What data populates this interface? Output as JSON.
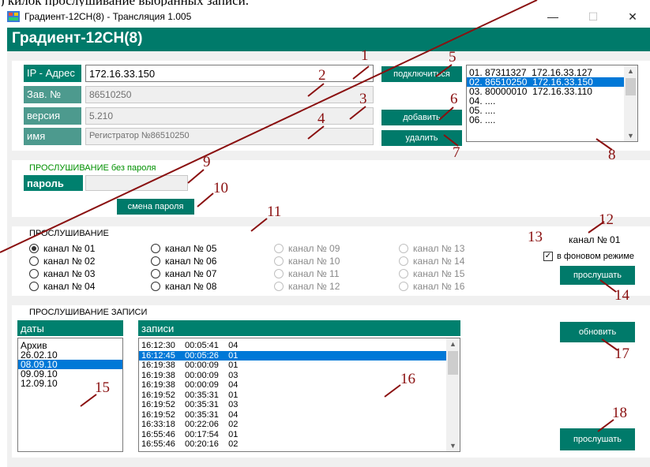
{
  "doc_caption": ") килок прослушивание выбранных записи.",
  "window": {
    "title": "Градиент-12СН(8) - Трансляция 1.005",
    "minimize_glyph": "—",
    "maximize_glyph": "☐",
    "close_glyph": "✕"
  },
  "header": {
    "title": "Градиент-12СН(8)"
  },
  "connection": {
    "ip_label": "IP - Адрес",
    "ip_value": "172.16.33.150",
    "serial_label": "Зав. №",
    "serial_value": "86510250",
    "version_label": "версия",
    "version_value": "5.210",
    "name_label": "имя",
    "name_value": "Регистратор №86510250",
    "connect_button": "подключиться",
    "add_button": "добавить",
    "delete_button": "удалить"
  },
  "devices": [
    "01. 87311327  172.16.33.127",
    "02. 86510250  172.16.33.150",
    "03. 80000010  172.16.33.110",
    "04. ....",
    "05. ....",
    "06. ...."
  ],
  "devices_selected_index": 1,
  "password": {
    "heading_main": "ПРОСЛУШИВАНИЕ",
    "heading_rest": " без пароля",
    "label": "пароль",
    "value": "",
    "change_button": "смена пароля"
  },
  "listening": {
    "heading": "ПРОСЛУШИВАНИЕ",
    "channels": [
      "канал № 01",
      "канал № 02",
      "канал № 03",
      "канал № 04",
      "канал № 05",
      "канал № 06",
      "канал № 07",
      "канал № 08",
      "канал № 09",
      "канал № 10",
      "канал № 11",
      "канал № 12",
      "канал № 13",
      "канал № 14",
      "канал № 15",
      "канал № 16"
    ],
    "selected_channel_index": 0,
    "current_channel": "канал № 01",
    "background_label": "в фоновом режиме",
    "background_checked": true,
    "listen_button": "прослушать"
  },
  "records": {
    "heading": "ПРОСЛУШИВАНИЕ ЗАПИСИ",
    "dates_label": "даты",
    "dates": [
      "Архив",
      "26.02.10",
      "08.09.10",
      "09.09.10",
      "12.09.10"
    ],
    "dates_selected_index": 2,
    "records_label": "записи",
    "rows": [
      "16:12:30    00:05:41    04",
      "16:12:45    00:05:26    01",
      "16:19:38    00:00:09    01",
      "16:19:38    00:00:09    03",
      "16:19:38    00:00:09    04",
      "16:19:52    00:35:31    01",
      "16:19:52    00:35:31    03",
      "16:19:52    00:35:31    04",
      "16:33:18    00:22:06    02",
      "16:55:46    00:17:54    01",
      "16:55:46    00:20:16    02"
    ],
    "rows_selected_index": 1,
    "refresh_button": "обновить",
    "play_button": "прослушать"
  },
  "callouts": [
    "1",
    "2",
    "3",
    "4",
    "5",
    "6",
    "7",
    "8",
    "9",
    "10",
    "11",
    "12",
    "13",
    "14",
    "15",
    "16",
    "17",
    "18"
  ],
  "colors": {
    "accent": "#007a6a",
    "selection": "#0078d7",
    "callout": "#8a1010",
    "panel_bg": "#f0f0f0"
  }
}
